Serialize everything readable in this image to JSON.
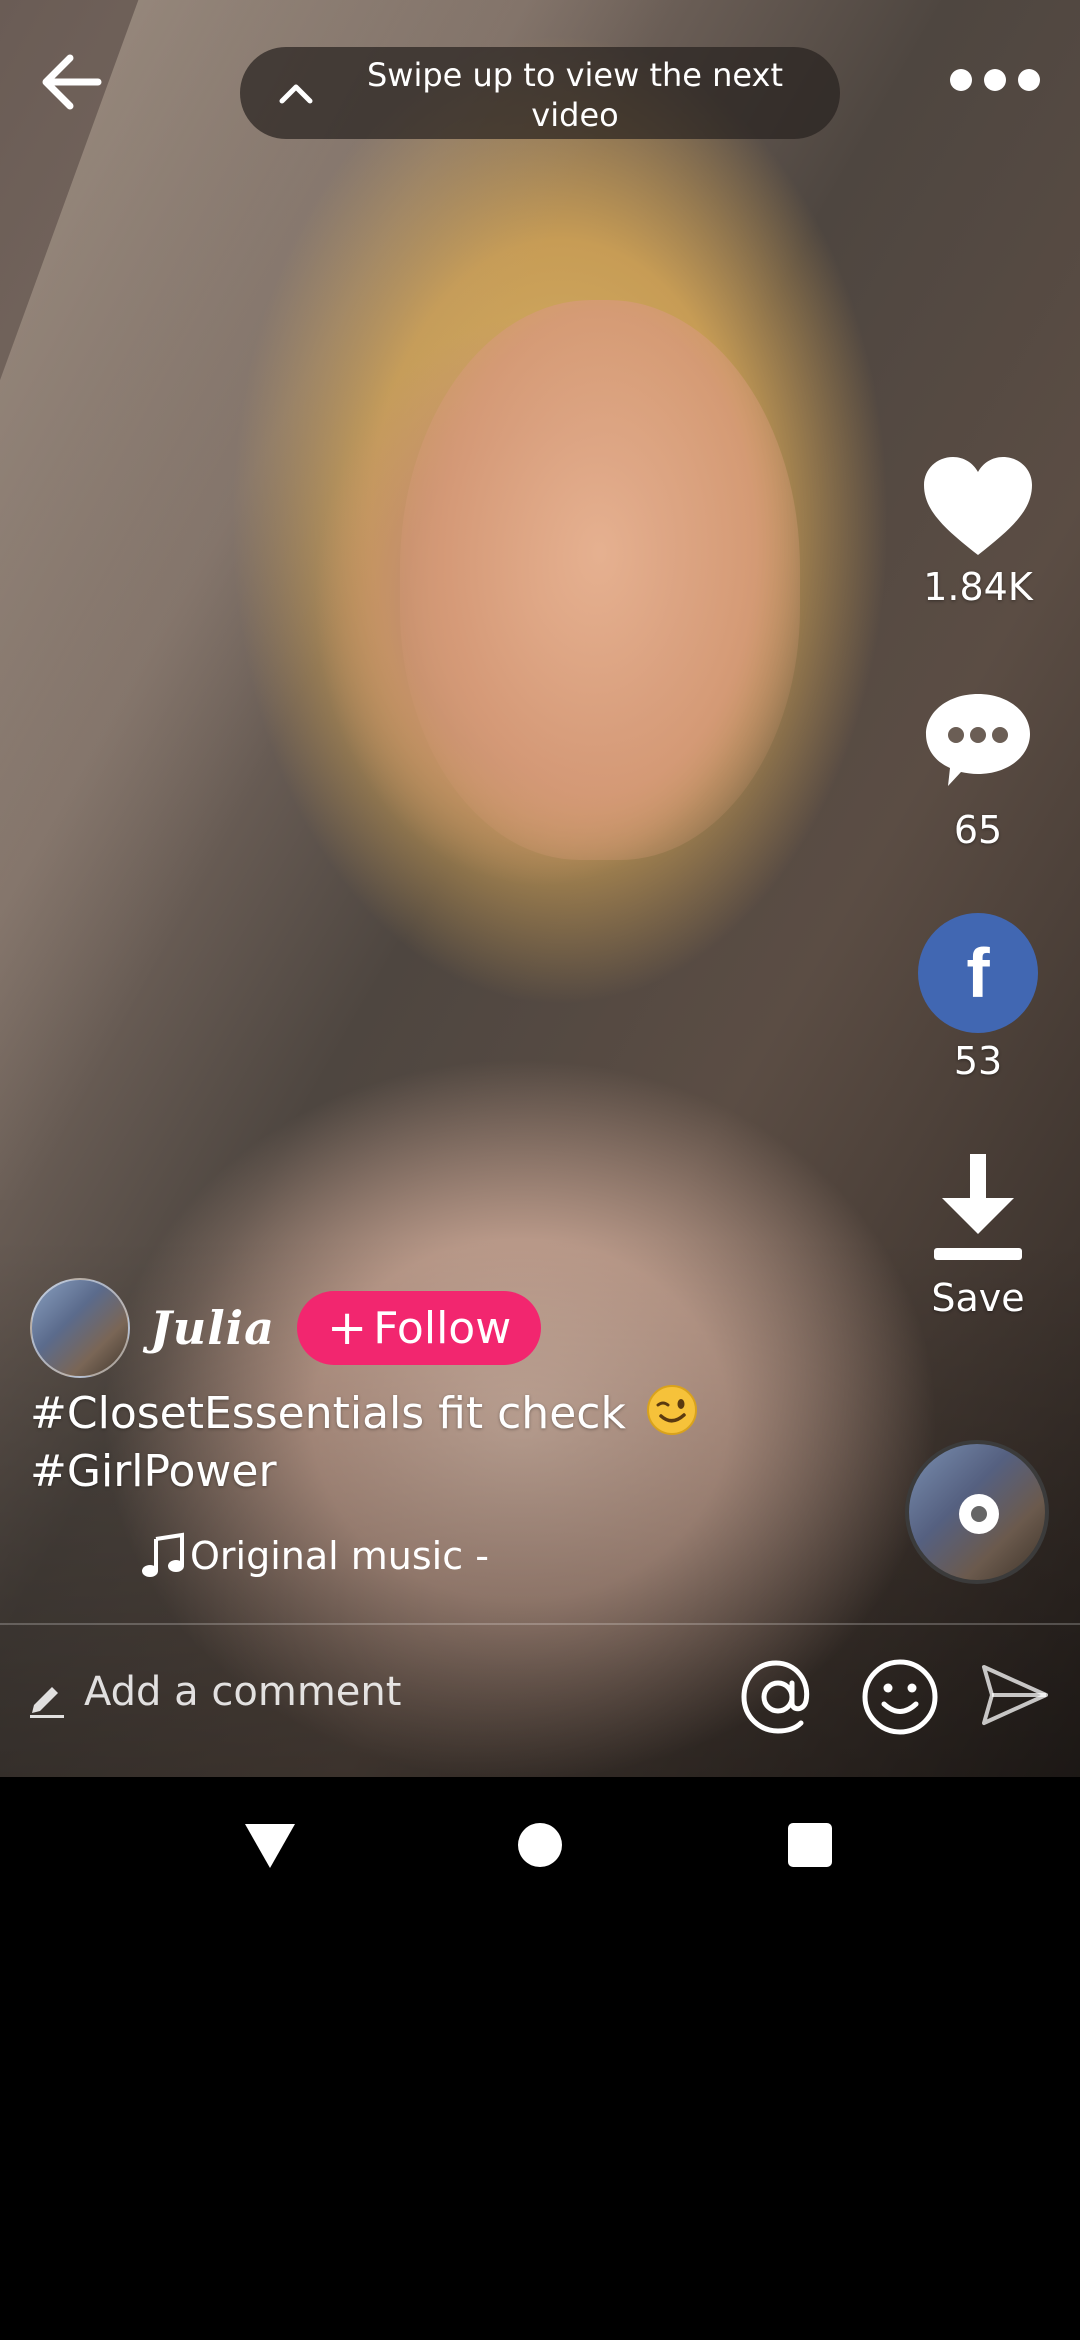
{
  "header": {
    "swipe_hint": "Swipe up to view the next video"
  },
  "actions": {
    "likes": "1.84K",
    "comments": "65",
    "facebook_shares": "53",
    "save_label": "Save"
  },
  "icons": {
    "back": "arrow-left-icon",
    "swipe": "chevron-up-icon",
    "more": "more-dots-icon",
    "like": "heart-icon",
    "comment": "speech-bubble-icon",
    "facebook": "facebook-icon",
    "facebook_glyph": "f",
    "save": "download-icon",
    "music": "music-note-icon",
    "pencil": "pencil-icon",
    "at": "at-sign-icon",
    "emoji": "smiley-icon",
    "send": "send-icon"
  },
  "author": {
    "name": "Julia",
    "follow_label": "Follow",
    "follow_plus": "+"
  },
  "caption": {
    "line1": "#ClosetEssentials  fit check",
    "line2": "#GirlPower"
  },
  "music": {
    "title": "Original music -"
  },
  "comment_bar": {
    "placeholder": "Add a comment"
  },
  "colors": {
    "follow": "#f2266f",
    "facebook": "#4167b2",
    "nav_background": "#000000"
  }
}
